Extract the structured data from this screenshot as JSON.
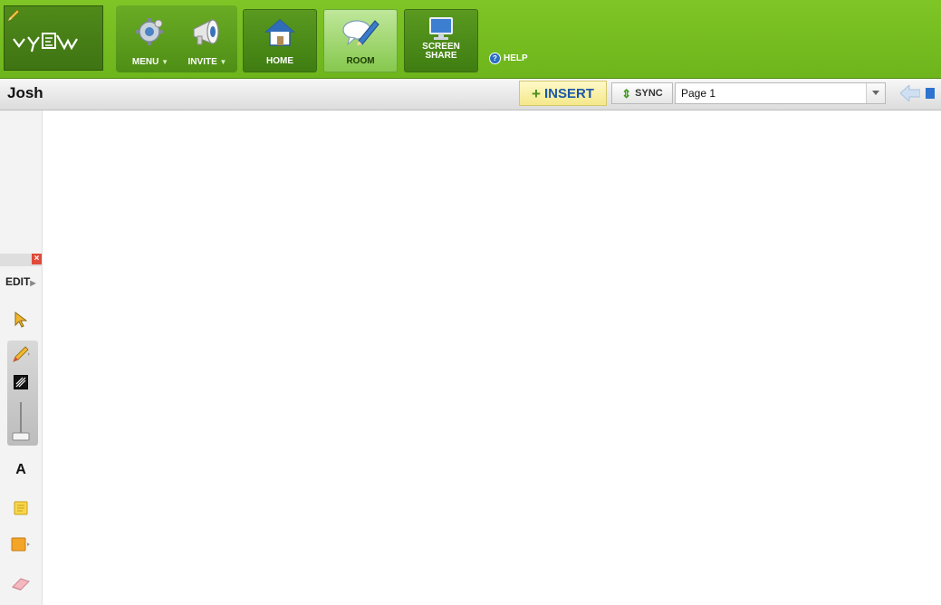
{
  "nav": {
    "menu_label": "MENU",
    "invite_label": "INVITE",
    "home_label": "HOME",
    "room_label": "ROOM",
    "screen_share_label_1": "SCREEN",
    "screen_share_label_2": "SHARE",
    "help_label": "HELP"
  },
  "room": {
    "name": "Josh",
    "insert_label": "INSERT",
    "sync_label": "SYNC",
    "page_selected": "Page 1"
  },
  "tools": {
    "edit_label": "EDIT",
    "text_tool_label": "A"
  },
  "colors": {
    "brand_green": "#7fc526",
    "insert_bg": "#fff3b0",
    "close_red": "#e04a3a"
  }
}
